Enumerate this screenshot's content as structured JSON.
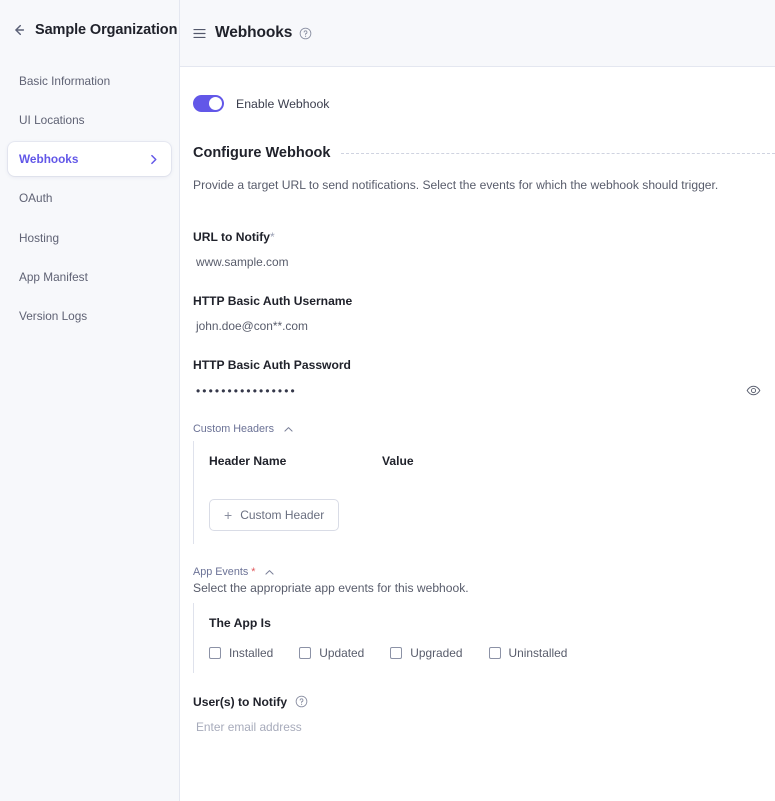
{
  "sidebar": {
    "back_icon": "back-arrow-icon",
    "org_title": "Sample Organization",
    "items": [
      {
        "label": "Basic Information",
        "active": false
      },
      {
        "label": "UI Locations",
        "active": false
      },
      {
        "label": "Webhooks",
        "active": true
      },
      {
        "label": "OAuth",
        "active": false
      },
      {
        "label": "Hosting",
        "active": false
      },
      {
        "label": "App Manifest",
        "active": false
      },
      {
        "label": "Version Logs",
        "active": false
      }
    ]
  },
  "topbar": {
    "menu_icon": "hamburger-icon",
    "title": "Webhooks",
    "help_icon": "help-circle-icon"
  },
  "main": {
    "enable_toggle": {
      "label": "Enable Webhook",
      "state": "on"
    },
    "section": {
      "title": "Configure Webhook",
      "description": "Provide a target URL to send notifications. Select the events for which the webhook should trigger."
    },
    "url_field": {
      "label": "URL to Notify",
      "required_mark": "*",
      "value": "www.sample.com"
    },
    "username_field": {
      "label": "HTTP Basic Auth Username",
      "value": "john.doe@con**.com"
    },
    "password_field": {
      "label": "HTTP Basic Auth Password",
      "value": "••••••••••••••••",
      "reveal_icon": "eye-icon"
    },
    "custom_headers": {
      "label": "Custom Headers",
      "collapse_icon": "chevron-up-icon",
      "columns": [
        "Header Name",
        "Value"
      ],
      "add_button": {
        "icon": "plus-icon",
        "label": "Custom Header"
      }
    },
    "app_events": {
      "label": "App Events",
      "required_mark": "*",
      "collapse_icon": "chevron-up-icon",
      "description": "Select the appropriate app events for this webhook.",
      "group_title": "The App Is",
      "options": [
        {
          "label": "Installed",
          "checked": false
        },
        {
          "label": "Updated",
          "checked": false
        },
        {
          "label": "Upgraded",
          "checked": false
        },
        {
          "label": "Uninstalled",
          "checked": false
        }
      ]
    },
    "users_to_notify": {
      "label": "User(s) to Notify",
      "help_icon": "help-circle-icon",
      "placeholder": "Enter email address"
    }
  },
  "colors": {
    "accent": "#6257e8",
    "sidebar_bg": "#f7f8fb",
    "text_primary": "#20222b",
    "text_muted": "#585c6b",
    "required_red": "#e0575b"
  }
}
